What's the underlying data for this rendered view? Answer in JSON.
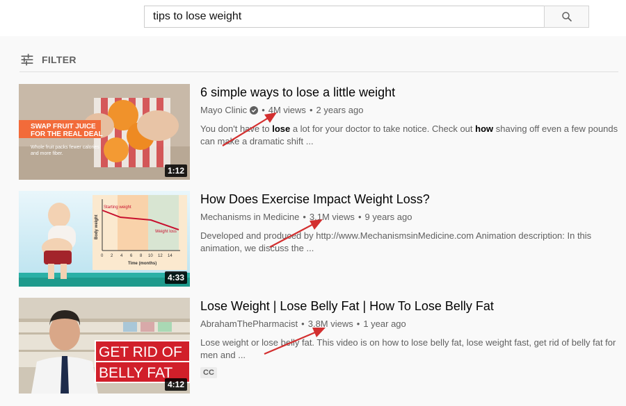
{
  "search": {
    "query": "tips to lose weight"
  },
  "filter": {
    "label": "FILTER"
  },
  "results": [
    {
      "title": "6 simple ways to lose a little weight",
      "channel": "Mayo Clinic",
      "verified": true,
      "views": "4M views",
      "age": "2 years ago",
      "desc_parts": [
        "You don't have to ",
        "lose",
        " a lot for your doctor to take notice. Check out ",
        "how",
        " shaving off even a few pounds can make a dramatic shift ..."
      ],
      "duration": "1:12",
      "thumb_text": {
        "line1": "SWAP FRUIT JUICE",
        "line2": "FOR THE REAL DEAL",
        "caption1": "Whole fruit packs fewer calories",
        "caption2": "and more fiber."
      }
    },
    {
      "title": "How Does Exercise Impact Weight Loss?",
      "channel": "Mechanisms in Medicine",
      "views": "3.1M views",
      "age": "9 years ago",
      "desc": "Developed and produced by http://www.MechanismsinMedicine.com Animation description: In this animation, we discuss the ...",
      "duration": "4:33",
      "thumb_text": {
        "starting": "Starting weight",
        "loss": "Weight loss",
        "ylabel": "Body weight",
        "xlabel": "Time (months)",
        "ticks": [
          "0",
          "2",
          "4",
          "6",
          "8",
          "10",
          "12",
          "14"
        ]
      }
    },
    {
      "title": "Lose Weight | Lose Belly Fat | How To Lose Belly Fat",
      "channel": "AbrahamThePharmacist",
      "views": "3.8M views",
      "age": "1 year ago",
      "desc": "Lose weight or lose belly fat. This video is on how to lose belly fat, lose weight fast, get rid of belly fat for men and ...",
      "badge": "CC",
      "duration": "4:12",
      "thumb_text": {
        "line1": "GET RID OF",
        "line2": "BELLY FAT"
      }
    }
  ],
  "colors": {
    "annotation_arrow": "#d32f2f",
    "thumb_overlay": "#f26b3a"
  }
}
